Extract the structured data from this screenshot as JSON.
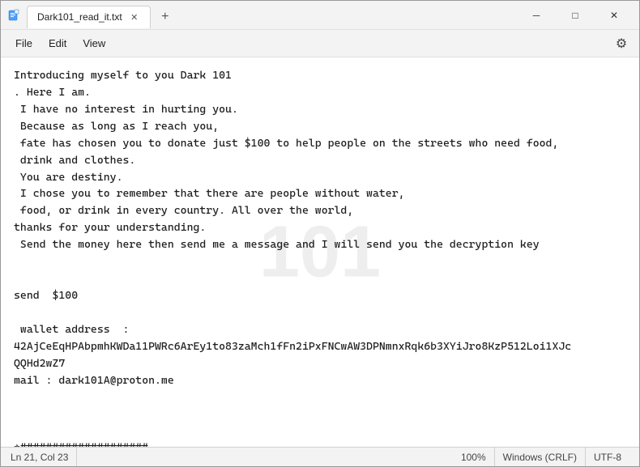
{
  "titleBar": {
    "tabLabel": "Dark101_read_it.txt",
    "newTabLabel": "+",
    "minimizeLabel": "─",
    "maximizeLabel": "□",
    "closeLabel": "✕"
  },
  "menuBar": {
    "file": "File",
    "edit": "Edit",
    "view": "View",
    "gearSymbol": "⚙"
  },
  "editor": {
    "content": "Introducing myself to you Dark 101\n. Here I am.\n I have no interest in hurting you.\n Because as long as I reach you,\n fate has chosen you to donate just $100 to help people on the streets who need food,\n drink and clothes.\n You are destiny.\n I chose you to remember that there are people without water,\n food, or drink in every country. All over the world,\nthanks for your understanding.\n Send the money here then send me a message and I will send you the decryption key\n\n\nsend  $100\n\n wallet address  :\n42AjCeEqHPAbpmhKWDa11PWRc6ArEy1to83zaMch1fFn2iPxFNCwAW3DPNmnxRqk6b3XYiJro8KzP512Loi1XJc\nQQHd2wZ7\nmail : dark101A@proton.me\n\n\n\n*####################",
    "watermark": "101"
  },
  "statusBar": {
    "position": "Ln 21, Col 23",
    "zoom": "100%",
    "lineEnding": "Windows (CRLF)",
    "encoding": "UTF-8"
  }
}
